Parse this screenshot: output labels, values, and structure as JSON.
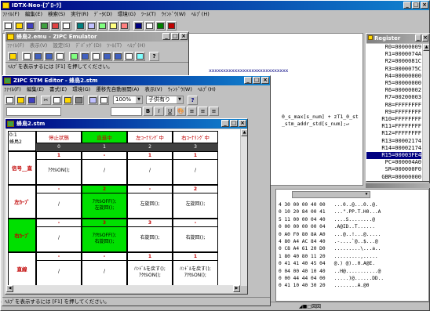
{
  "main": {
    "title": "IDTX-Neo-[ﾌﾟﾛｰﾗ]",
    "menu": [
      "ﾌｧｲﾙ(F)",
      "編集(E)",
      "検索(S)",
      "実行(R)",
      "ﾃﾞｰﾀ(D)",
      "環境(G)",
      "ﾂｰﾙ(T)",
      "ｳｲﾝﾄﾞｳ(W)",
      "ﾍﾙﾌﾟ(H)"
    ],
    "code_line1": "0_s_max[s_num] + zT1_0_st",
    "code_line2": "_stm_addr_std[s_num];↵",
    "marks": "xxxxxxxxxxxxxxxxxxxxxxxxxxxx"
  },
  "emu": {
    "title": "蜂鳥2.emu - ZIPC Emulator",
    "menu": [
      "ﾌｧｲﾙ(F)",
      "表示(V)",
      "設定(S)",
      "ﾃﾞﾊﾞｯｸﾞ(D)",
      "ﾂｰﾙ(T)",
      "ﾍﾙﾌﾟ(H)"
    ],
    "status": "ﾍﾙﾌﾟを表示するには [F1] を押してください。"
  },
  "stm": {
    "title": "ZIPC STM Editor - 蜂鳥2.stm",
    "menu": [
      "ﾌｧｲﾙ(F)",
      "編集(E)",
      "書式(E)",
      "環境(G)",
      "遷移先自動展開(A)",
      "表示(V)",
      "ｳｨﾝﾄﾞｳ(W)",
      "ﾍﾙﾌﾟ(H)"
    ],
    "zoom": "100%",
    "combo": "子供有り",
    "status": "ﾍﾙﾌﾟを表示するには [F1] を押してください。"
  },
  "doc": {
    "title": "蜂鳥2.stm",
    "corner": "0:1\n蜂鳥2",
    "headers": [
      "停止状態",
      "直進中",
      "左ｺｰﾅﾘﾝｸﾞ中",
      "右ｺｰﾅﾘﾝｸﾞ中"
    ],
    "indices": [
      "0",
      "1",
      "2",
      "3"
    ],
    "rows": [
      {
        "label": "信号__直",
        "cells": [
          {
            "n": "1",
            "t": "ｱｸｾﾙON();"
          },
          {
            "n": "-",
            "t": "/"
          },
          {
            "n": "1",
            "t": "/"
          },
          {
            "n": "1",
            "t": "/"
          }
        ]
      },
      {
        "label": "左ｶｰﾌﾞ",
        "cells": [
          {
            "n": "-",
            "t": "/"
          },
          {
            "n": "2",
            "t": "ｱｸｾﾙOFF();\n左旋回();"
          },
          {
            "n": "-",
            "t": "左旋回();"
          },
          {
            "n": "2",
            "t": "左旋回();"
          }
        ]
      },
      {
        "label": "右ｶｰﾌﾞ",
        "cells": [
          {
            "n": "-",
            "t": "/"
          },
          {
            "n": "3",
            "t": "ｱｸｾﾙOFF();\n右旋回();"
          },
          {
            "n": "3",
            "t": "右旋回();"
          },
          {
            "n": "-",
            "t": "右旋回();"
          }
        ]
      },
      {
        "label": "直線",
        "cells": [
          {
            "n": "-",
            "t": "/"
          },
          {
            "n": "-",
            "t": "/"
          },
          {
            "n": "1",
            "t": "ﾊﾝﾄﾞﾙを戻す();\nｱｸｾﾙON();"
          },
          {
            "n": "1",
            "t": "ﾊﾝﾄﾞﾙを戻す();\nｱｸｾﾙON();"
          }
        ]
      }
    ]
  },
  "register": {
    "title": "Register",
    "lines": [
      "R0=00000009",
      "R1=0000074A",
      "R2=0000081C",
      "R3=0000075C",
      "R4=00000000",
      "R5=00000000",
      "R6=00000002",
      "R7=00200003",
      "R8=FFFFFFFF",
      "R9=FFFFFFFF",
      "R10=FFFFFFFF",
      "R11=FFFFFFFF",
      "R12=FFFFFFFF",
      "R13=00002174",
      "R14=00002174",
      "R15=00003FE4",
      "PC=000004A0",
      "SR=000000F0",
      "GBR=00000000"
    ]
  },
  "memory": {
    "lines": [
      "4 30 00 00 40 00   ...0..@...0..@.",
      "0 10 20 84 00 41   ...\".PP.T.H0...A",
      "5 11 00 00 04 40   ....S........@",
      "0 00 00 00 00 04   .A@ID..T......",
      "0 A0 F0 80 8A A0   ...@..!...@.....",
      "4 80 A4 AC 84 40   .-....`@..$...@",
      "0 C8 A4 61 20 D0   .........\\...a..",
      "1 80 40 80 11 20   .........,.....",
      "0 41 41 40 45 04   @.) @)..0.A@E.",
      "0 04 00 40 10 40   ..H@...........@",
      "0 00 44 44 04 00   .....)@......DD..",
      "0 41 10 40 30 20   ........A.@0"
    ]
  }
}
